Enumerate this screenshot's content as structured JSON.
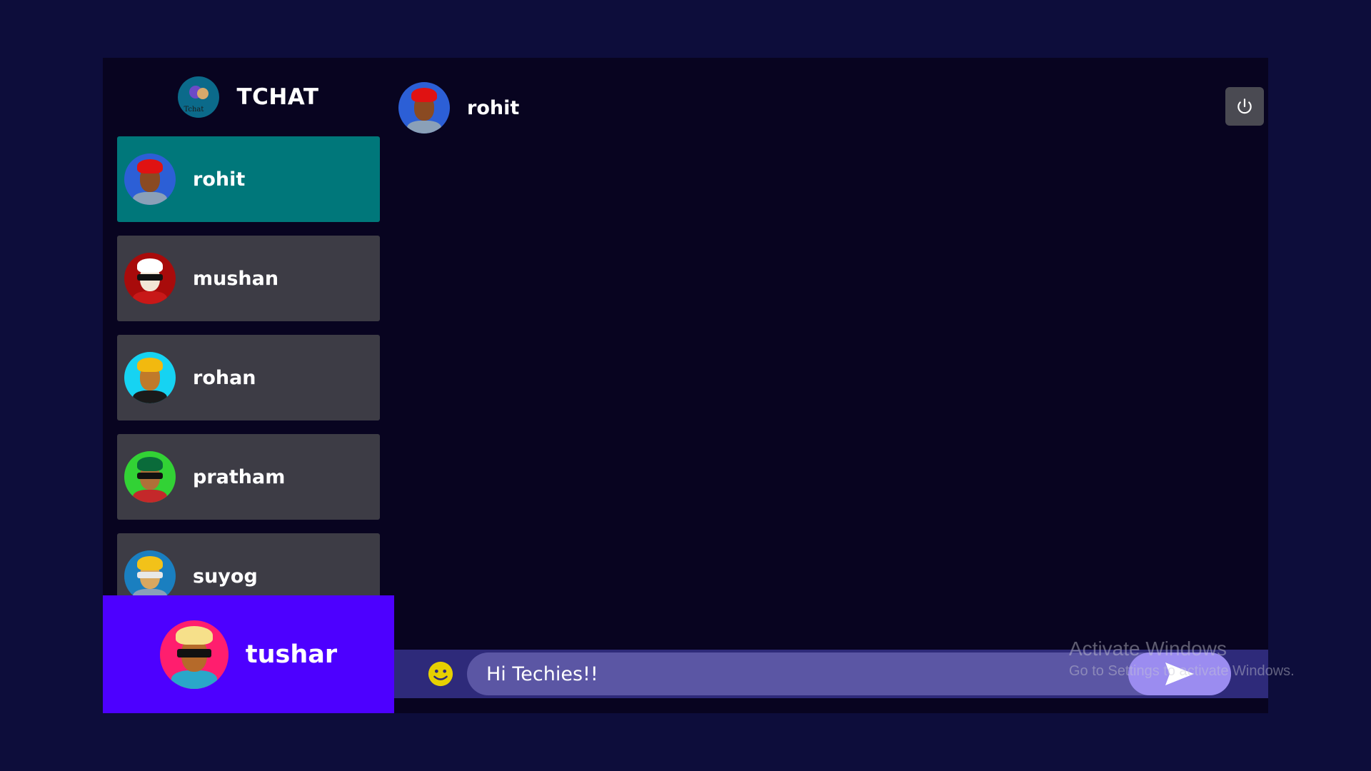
{
  "app": {
    "brand_name": "TCHAT",
    "brand_logo_text": "Tchat"
  },
  "contacts": [
    {
      "name": "rohit",
      "selected": true,
      "avatar": "avatar-red-hair"
    },
    {
      "name": "mushan",
      "selected": false,
      "avatar": "avatar-sunglasses"
    },
    {
      "name": "rohan",
      "selected": false,
      "avatar": "avatar-yellow-hair"
    },
    {
      "name": "pratham",
      "selected": false,
      "avatar": "avatar-green-hair"
    },
    {
      "name": "suyog",
      "selected": false,
      "avatar": "avatar-glasses"
    }
  ],
  "current_user": {
    "name": "tushar",
    "avatar": "avatar-dreadlocks"
  },
  "chat": {
    "title": "rohit",
    "logout_icon": "power-icon"
  },
  "composer": {
    "input_value": "Hi Techies!!",
    "emoji_icon": "smile-icon",
    "send_icon": "send-icon"
  },
  "watermark": {
    "line1": "Activate Windows",
    "line2": "Go to Settings to activate Windows."
  },
  "colors": {
    "page_bg": "#0d0d3b",
    "panel_bg": "#080420",
    "selected_contact": "#00777a",
    "contact_bg": "#3d3c45",
    "current_user_bg": "#4d00ff",
    "composer_bg": "#2e2a7a",
    "send_button": "#9b8cf0"
  }
}
